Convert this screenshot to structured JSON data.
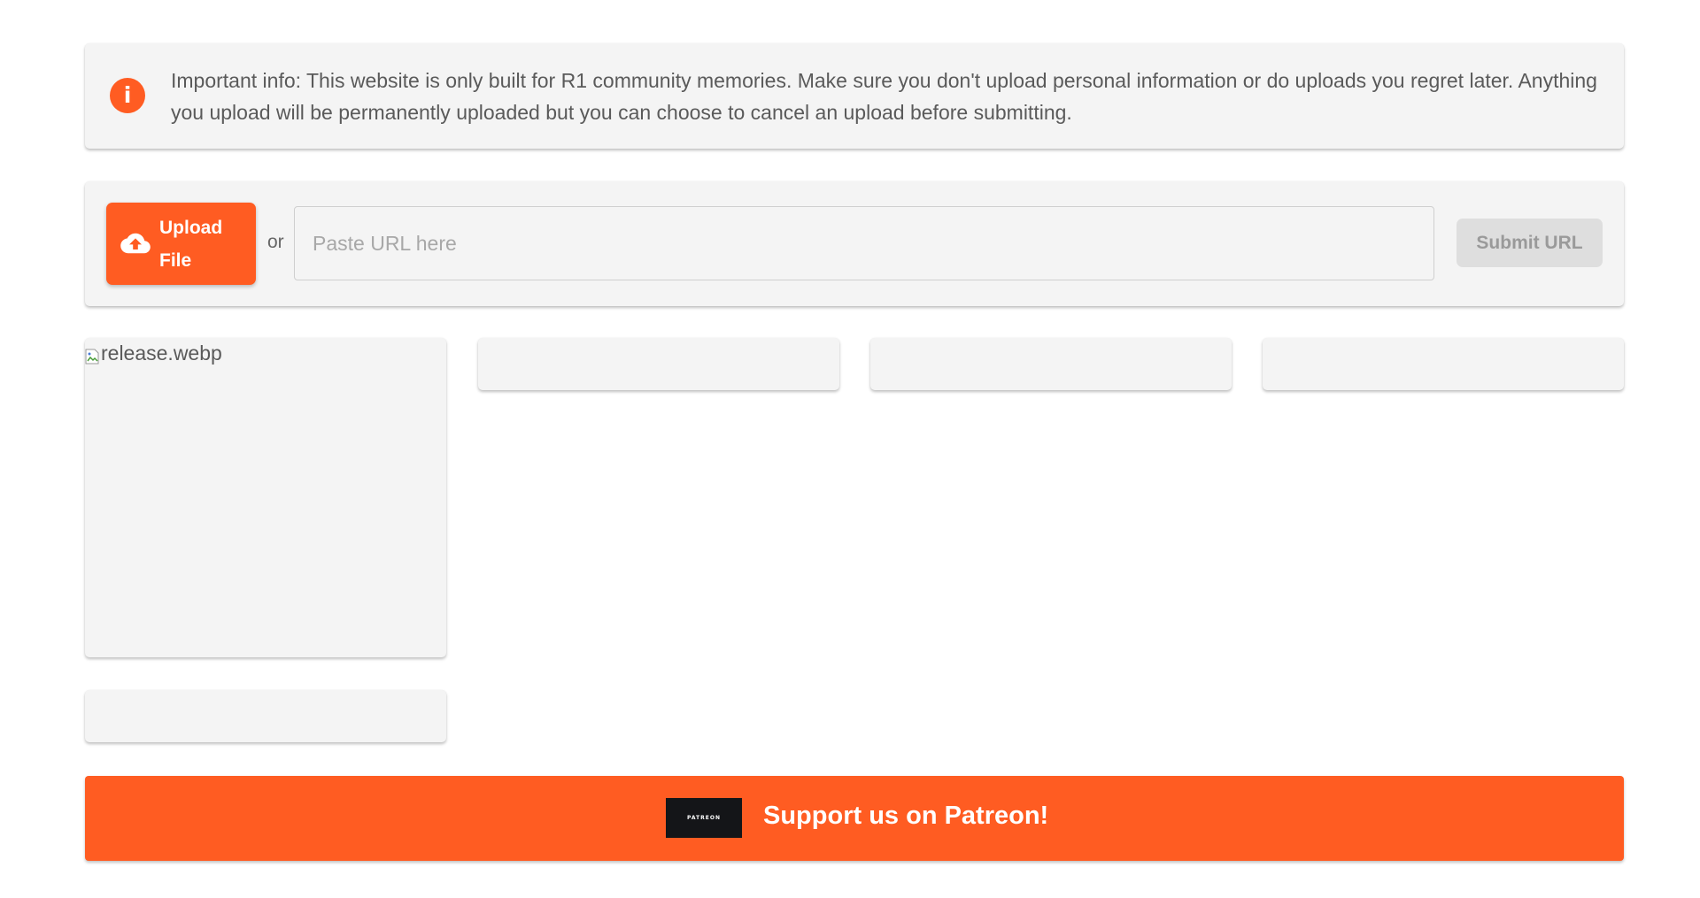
{
  "info_banner": {
    "icon": "info-icon",
    "icon_glyph": "i",
    "text": "Important info: This website is only built for R1 community memories. Make sure you don't upload personal information or do uploads you regret later. Anything you upload will be permanently uploaded but you can choose to cancel an upload before submitting."
  },
  "upload": {
    "upload_button_label": "Upload File",
    "upload_icon": "cloud-upload-icon",
    "or_text": "or",
    "url_placeholder": "Paste URL here",
    "url_value": "",
    "submit_label": "Submit URL"
  },
  "gallery": {
    "broken_image_alt": "release.webp"
  },
  "patreon": {
    "logo_text": "PATREON",
    "label": "Support us on Patreon!"
  },
  "colors": {
    "accent": "#ff5c22",
    "card_background": "#f4f4f4",
    "disabled_button": "#dedede",
    "patreon_logo_bg": "#141518"
  }
}
